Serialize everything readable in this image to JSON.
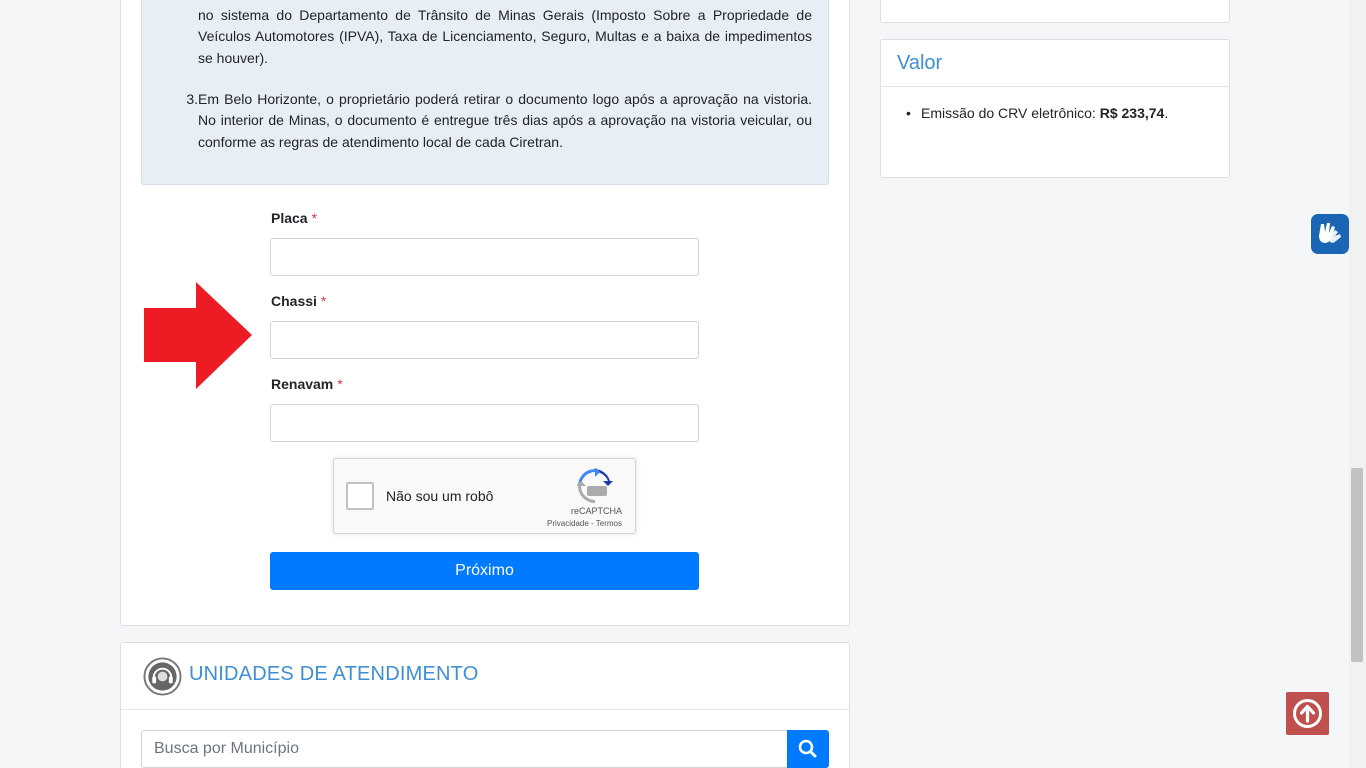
{
  "info": {
    "item2_continuation": "no sistema do Departamento de Trânsito de Minas Gerais (Imposto Sobre a Propriedade de Veículos Automotores (IPVA), Taxa de Licenciamento, Seguro, Multas e a baixa de impedimentos se houver).",
    "item3_number": "3.",
    "item3_text": "Em Belo Horizonte, o proprietário poderá retirar o documento logo após a aprovação na vistoria. No interior de Minas, o documento é entregue três dias após a aprovação na vistoria veicular, ou conforme as regras de atendimento local de cada Ciretran."
  },
  "form": {
    "placa_label": "Placa",
    "chassi_label": "Chassi",
    "renavam_label": "Renavam",
    "required_mark": "*",
    "recaptcha_label": "Não sou um robô",
    "recaptcha_brand": "reCAPTCHA",
    "recaptcha_links": "Privacidade - Termos",
    "next_button": "Próximo"
  },
  "units": {
    "title": "UNIDADES DE ATENDIMENTO",
    "search_placeholder": "Busca por Município"
  },
  "valor": {
    "title": "Valor",
    "item_label": "Emissão do CRV eletrônico: ",
    "item_value": "R$ 233,74",
    "item_suffix": "."
  },
  "colors": {
    "accent": "#3d8fd6",
    "primary_button": "#007bff",
    "arrow": "#ed1c24",
    "to_top_button": "#c0504d",
    "vlibras": "#1a66b5"
  },
  "icons": [
    "recaptcha-logo-icon",
    "arrow-right-icon",
    "headset-icon",
    "search-icon",
    "vlibras-hands-icon",
    "arrow-up-circle-icon"
  ]
}
